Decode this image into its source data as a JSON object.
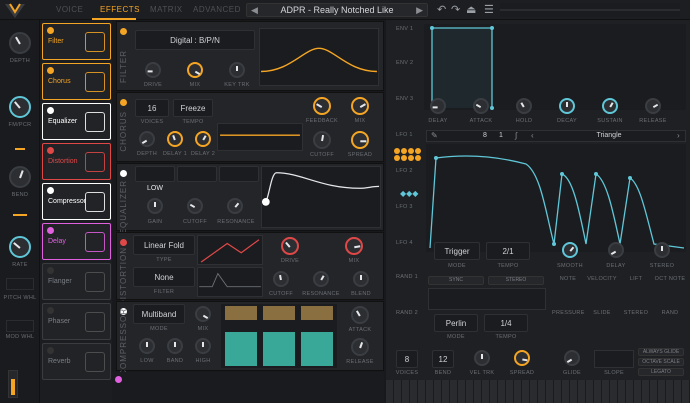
{
  "topbar": {
    "tabs": [
      "VOICE",
      "EFFECTS",
      "MATRIX",
      "ADVANCED"
    ],
    "active_tab": "EFFECTS",
    "preset_name": "ADPR - Really Notched Like",
    "prev_arrow": "◀",
    "next_arrow": "▶"
  },
  "left_controls": {
    "labels": [
      "DEPTH",
      "FM/PCR",
      "BEND",
      "RATE",
      "PITCH WHL",
      "MOD WHL"
    ]
  },
  "effects_list": [
    {
      "name": "Filter",
      "color": "#f5a524",
      "icon": "filter-curve-icon"
    },
    {
      "name": "Chorus",
      "color": "#f5a524",
      "icon": "chorus-rings-icon"
    },
    {
      "name": "Equalizer",
      "color": "#ffffff",
      "icon": "equalizer-diamond-icon"
    },
    {
      "name": "Distortion",
      "color": "#e04848",
      "icon": "distortion-shape-icon"
    },
    {
      "name": "Compressor",
      "color": "#ffffff",
      "icon": "compressor-wave-icon"
    },
    {
      "name": "Delay",
      "color": "#e060e0",
      "icon": "delay-bars-icon"
    },
    {
      "name": "Flanger",
      "color": "#888888",
      "icon": "flanger-comb-icon"
    },
    {
      "name": "Phaser",
      "color": "#888888",
      "icon": "phaser-wave-icon"
    },
    {
      "name": "Reverb",
      "color": "#888888",
      "icon": "reverb-cube-icon"
    }
  ],
  "filter_panel": {
    "title": "FILTER",
    "mode": "Digital : B/P/N",
    "knobs": [
      "DRIVE",
      "MIX",
      "KEY TRK"
    ]
  },
  "chorus_panel": {
    "title": "CHORUS",
    "voices_value": "16",
    "voices_label": "VOICES",
    "tempo_value": "Freeze",
    "tempo_label": "TEMPO",
    "knobs": [
      "FEEDBACK",
      "MIX",
      "DEPTH",
      "DELAY 1",
      "DELAY 2",
      "CUTOFF",
      "SPREAD"
    ]
  },
  "eq_panel": {
    "title": "EQUALIZER",
    "band_low": "LOW",
    "knobs": [
      "GAIN",
      "CUTOFF",
      "RESONANCE"
    ]
  },
  "distortion_panel": {
    "title": "DISTORTION",
    "type_value": "Linear Fold",
    "type_label": "TYPE",
    "filter_value": "None",
    "filter_label": "FILTER",
    "knobs": [
      "DRIVE",
      "MIX",
      "CUTOFF",
      "RESONANCE",
      "BLEND"
    ]
  },
  "compressor_panel": {
    "title": "COMPRESSOR",
    "mode_value": "Multiband",
    "mode_label": "MODE",
    "knobs": [
      "MIX",
      "LOW",
      "BAND",
      "HIGH",
      "ATTACK",
      "RELEASE"
    ]
  },
  "envelopes": {
    "labels": [
      "ENV 1",
      "ENV 2",
      "ENV 3"
    ],
    "knobs": [
      "DELAY",
      "ATTACK",
      "HOLD",
      "DECAY",
      "SUSTAIN",
      "RELEASE"
    ]
  },
  "lfos": {
    "labels": [
      "LFO 1",
      "LFO 2",
      "LFO 3",
      "LFO 4"
    ],
    "shape": "Triangle",
    "frac_num": "8",
    "frac_den": "1",
    "mode_value": "Trigger",
    "mode_label": "MODE",
    "tempo_value": "2/1",
    "tempo_label": "TEMPO",
    "knobs": [
      "SMOOTH",
      "DELAY",
      "STEREO"
    ]
  },
  "random": {
    "labels": [
      "RAND 1",
      "RAND 2"
    ],
    "sync": "SYNC",
    "stereo": "STEREO",
    "mode_value": "Perlin",
    "mode_label": "MODE",
    "tempo_value": "1/4",
    "tempo_label": "TEMPO"
  },
  "mod_sources": [
    "NOTE",
    "VELOCITY",
    "LIFT",
    "OCT NOTE",
    "PRESSURE",
    "SLIDE",
    "STEREO",
    "RAND"
  ],
  "voice_footer": {
    "voices_value": "8",
    "voices_label": "VOICES",
    "bend_value": "12",
    "bend_label": "BEND",
    "knobs": [
      "VEL TRK",
      "SPREAD",
      "GLIDE",
      "SLOPE"
    ],
    "options": [
      "ALWAYS GLIDE",
      "OCTAVE SCALE",
      "LEGATO"
    ]
  }
}
